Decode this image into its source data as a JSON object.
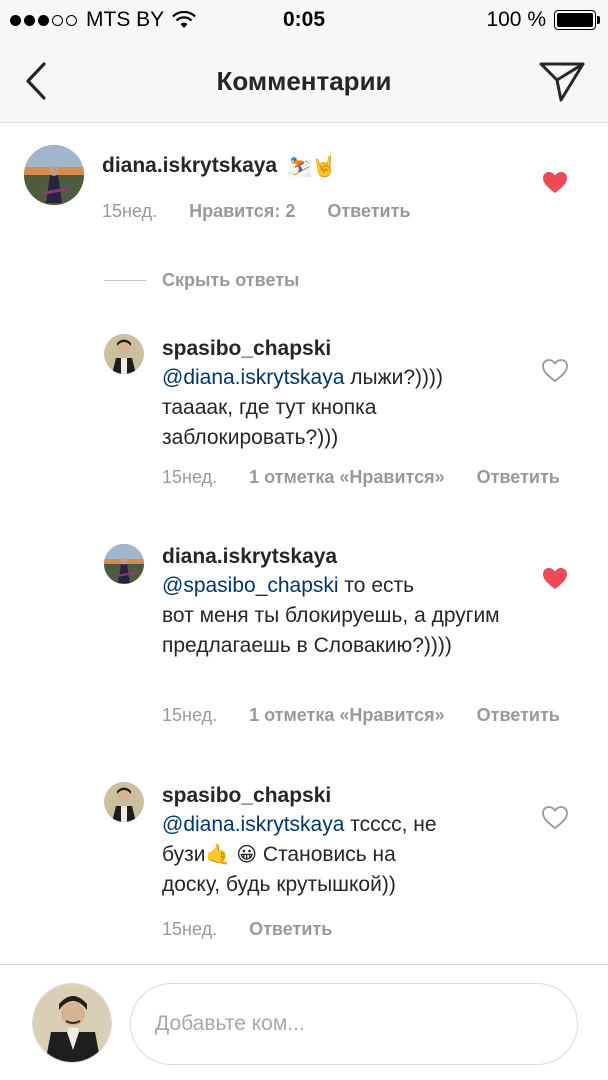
{
  "status_bar": {
    "carrier": "MTS BY",
    "time": "0:05",
    "battery": "100 %"
  },
  "nav": {
    "title": "Комментарии"
  },
  "comments": [
    {
      "username": "diana.iskrytskaya",
      "emojis": "⛷️🤘",
      "age": "15нед.",
      "likes": "Нравится: 2",
      "reply": "Ответить",
      "liked": true
    }
  ],
  "hide_replies": "Скрыть ответы",
  "replies": [
    {
      "username": "spasibo_chapski",
      "mention": "@diana.iskrytskaya",
      "text_line1": " лыжи?))))",
      "text_rest": "тааaак, где тут кнопка заблокировать?)))",
      "age": "15нед.",
      "likes": "1 отметка «Нравится»",
      "reply": "Ответить",
      "liked": false
    },
    {
      "username": "diana.iskrytskaya",
      "mention": "@spasibo_chapski",
      "text_line1": " то есть",
      "text_rest": "вот меня ты блокируешь, а другим предлагаешь в Словакию?))))",
      "age": "15нед.",
      "likes": "1 отметка «Нравится»",
      "reply": "Ответить",
      "liked": true
    },
    {
      "username": "spasibo_chapski",
      "mention": "@diana.iskrytskaya",
      "text_line1": " тсссс, не",
      "text_part_a": "бузи",
      "emoji_a": "🤙",
      "emoji_b": "😀",
      "text_part_b": "  Становись на",
      "text_rest": "доску, будь крутышкой))",
      "age": "15нед.",
      "reply": "Ответить",
      "liked": false
    }
  ],
  "composer": {
    "placeholder": "Добавьте ком..."
  },
  "colors": {
    "heart_liked": "#ed4956",
    "mention": "#003569",
    "meta": "#999999",
    "bar_bg": "#f7f7f7"
  }
}
